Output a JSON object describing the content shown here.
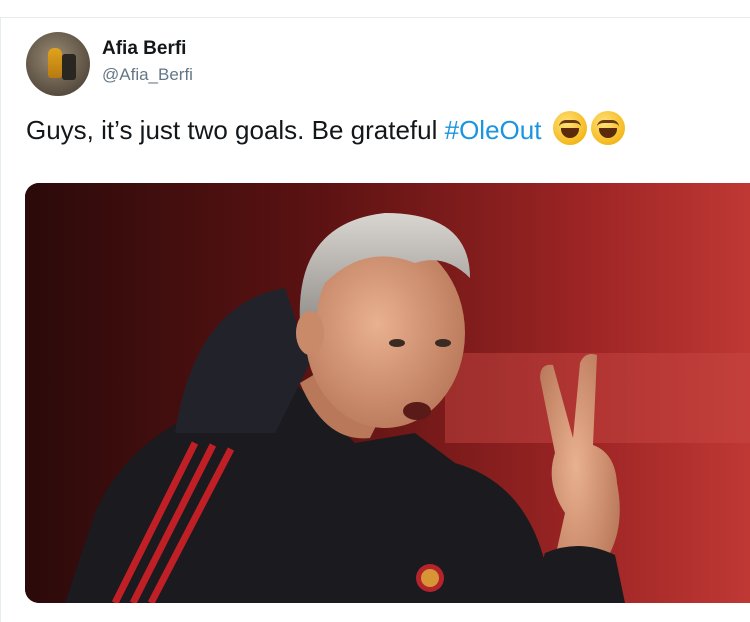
{
  "tweet": {
    "author": {
      "display_name": "Afia Berfi",
      "handle": "@Afia_Berfi"
    },
    "text": "Guys, it’s just two goals. Be grateful ",
    "hashtag": "#OleOut",
    "emoji": [
      "face-with-tears-of-joy",
      "face-with-tears-of-joy"
    ]
  },
  "colors": {
    "hashtag": "#1b95e0",
    "text": "#14171a",
    "handle": "#657786"
  }
}
